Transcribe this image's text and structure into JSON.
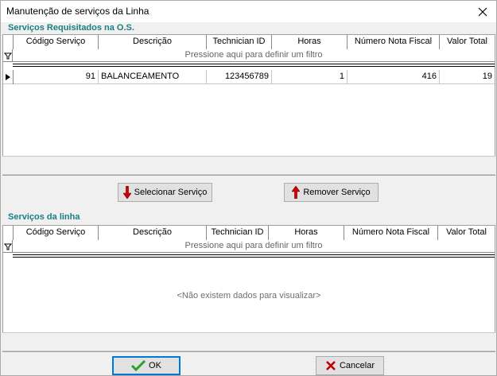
{
  "window": {
    "title": "Manutenção de serviços da Linha",
    "close_icon": "close-icon"
  },
  "requested": {
    "label": "Serviços Requisitados na O.S.",
    "columns": [
      "Código Serviço",
      "Descrição",
      "Technician ID",
      "Horas",
      "Número Nota Fiscal",
      "Valor Total"
    ],
    "filter_text": "Pressione aqui para definir um filtro",
    "rows": [
      {
        "codigo": "91",
        "descricao": "BALANCEAMENTO",
        "technician_id": "123456789",
        "horas": "1",
        "nota_fiscal": "416",
        "valor_total": "19"
      }
    ]
  },
  "actions": {
    "select_label": "Selecionar Serviço",
    "remove_label": "Remover Serviço"
  },
  "line_services": {
    "label": "Serviços da linha",
    "columns": [
      "Código Serviço",
      "Descrição",
      "Technician ID",
      "Horas",
      "Número Nota Fiscal",
      "Valor Total"
    ],
    "filter_text": "Pressione aqui para definir um filtro",
    "empty_text": "<Não existem dados para visualizar>"
  },
  "footer": {
    "ok_label": "OK",
    "cancel_label": "Cancelar"
  },
  "colors": {
    "section_label": "#1a7f82",
    "select_arrow": "#d40000",
    "remove_arrow": "#d40000",
    "ok_check": "#2ca02c",
    "cancel_x": "#c00000"
  }
}
